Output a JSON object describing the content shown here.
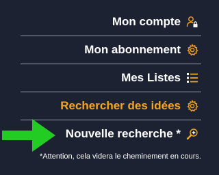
{
  "menu": {
    "items": [
      {
        "label": "Mon compte",
        "icon": "user-lock-icon",
        "active": false
      },
      {
        "label": "Mon abonnement",
        "icon": "gear-icon",
        "active": false
      },
      {
        "label": "Mes Listes",
        "icon": "list-icon",
        "active": false
      },
      {
        "label": "Rechercher des idées",
        "icon": "gear-icon",
        "active": true
      },
      {
        "label": "Nouvelle recherche *",
        "icon": "search-plus-icon",
        "active": false
      }
    ],
    "note": "*Attention, cela videra le cheminement en cours."
  },
  "colors": {
    "background": "#1d2232",
    "text": "#ffffff",
    "accent": "#f5a51e",
    "arrow": "#22cc22",
    "divider": "#9aa0ab"
  }
}
